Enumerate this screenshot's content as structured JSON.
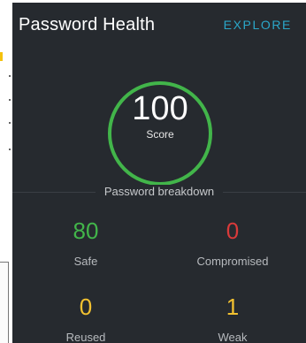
{
  "header": {
    "title": "Password Health",
    "explore_label": "EXPLORE"
  },
  "score": {
    "value": "100",
    "label": "Score"
  },
  "breakdown": {
    "title": "Password breakdown",
    "items": [
      {
        "value": "80",
        "label": "Safe",
        "color": "#42b54a"
      },
      {
        "value": "0",
        "label": "Compromised",
        "color": "#d93a3a"
      },
      {
        "value": "0",
        "label": "Reused",
        "color": "#f2c130"
      },
      {
        "value": "1",
        "label": "Weak",
        "color": "#f2c130"
      }
    ]
  },
  "colors": {
    "background": "#262a2f",
    "accent": "#2aa7c9",
    "ring": "#42b54a"
  }
}
